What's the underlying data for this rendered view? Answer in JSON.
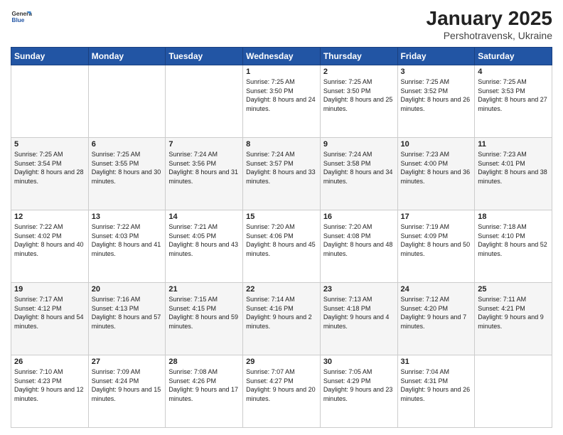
{
  "header": {
    "logo": {
      "general": "General",
      "blue": "Blue"
    },
    "title": "January 2025",
    "location": "Pershotravensk, Ukraine"
  },
  "weekdays": [
    "Sunday",
    "Monday",
    "Tuesday",
    "Wednesday",
    "Thursday",
    "Friday",
    "Saturday"
  ],
  "weeks": [
    [
      {
        "day": "",
        "sunrise": "",
        "sunset": "",
        "daylight": ""
      },
      {
        "day": "",
        "sunrise": "",
        "sunset": "",
        "daylight": ""
      },
      {
        "day": "",
        "sunrise": "",
        "sunset": "",
        "daylight": ""
      },
      {
        "day": "1",
        "sunrise": "Sunrise: 7:25 AM",
        "sunset": "Sunset: 3:50 PM",
        "daylight": "Daylight: 8 hours and 24 minutes."
      },
      {
        "day": "2",
        "sunrise": "Sunrise: 7:25 AM",
        "sunset": "Sunset: 3:50 PM",
        "daylight": "Daylight: 8 hours and 25 minutes."
      },
      {
        "day": "3",
        "sunrise": "Sunrise: 7:25 AM",
        "sunset": "Sunset: 3:52 PM",
        "daylight": "Daylight: 8 hours and 26 minutes."
      },
      {
        "day": "4",
        "sunrise": "Sunrise: 7:25 AM",
        "sunset": "Sunset: 3:53 PM",
        "daylight": "Daylight: 8 hours and 27 minutes."
      }
    ],
    [
      {
        "day": "5",
        "sunrise": "Sunrise: 7:25 AM",
        "sunset": "Sunset: 3:54 PM",
        "daylight": "Daylight: 8 hours and 28 minutes."
      },
      {
        "day": "6",
        "sunrise": "Sunrise: 7:25 AM",
        "sunset": "Sunset: 3:55 PM",
        "daylight": "Daylight: 8 hours and 30 minutes."
      },
      {
        "day": "7",
        "sunrise": "Sunrise: 7:24 AM",
        "sunset": "Sunset: 3:56 PM",
        "daylight": "Daylight: 8 hours and 31 minutes."
      },
      {
        "day": "8",
        "sunrise": "Sunrise: 7:24 AM",
        "sunset": "Sunset: 3:57 PM",
        "daylight": "Daylight: 8 hours and 33 minutes."
      },
      {
        "day": "9",
        "sunrise": "Sunrise: 7:24 AM",
        "sunset": "Sunset: 3:58 PM",
        "daylight": "Daylight: 8 hours and 34 minutes."
      },
      {
        "day": "10",
        "sunrise": "Sunrise: 7:23 AM",
        "sunset": "Sunset: 4:00 PM",
        "daylight": "Daylight: 8 hours and 36 minutes."
      },
      {
        "day": "11",
        "sunrise": "Sunrise: 7:23 AM",
        "sunset": "Sunset: 4:01 PM",
        "daylight": "Daylight: 8 hours and 38 minutes."
      }
    ],
    [
      {
        "day": "12",
        "sunrise": "Sunrise: 7:22 AM",
        "sunset": "Sunset: 4:02 PM",
        "daylight": "Daylight: 8 hours and 40 minutes."
      },
      {
        "day": "13",
        "sunrise": "Sunrise: 7:22 AM",
        "sunset": "Sunset: 4:03 PM",
        "daylight": "Daylight: 8 hours and 41 minutes."
      },
      {
        "day": "14",
        "sunrise": "Sunrise: 7:21 AM",
        "sunset": "Sunset: 4:05 PM",
        "daylight": "Daylight: 8 hours and 43 minutes."
      },
      {
        "day": "15",
        "sunrise": "Sunrise: 7:20 AM",
        "sunset": "Sunset: 4:06 PM",
        "daylight": "Daylight: 8 hours and 45 minutes."
      },
      {
        "day": "16",
        "sunrise": "Sunrise: 7:20 AM",
        "sunset": "Sunset: 4:08 PM",
        "daylight": "Daylight: 8 hours and 48 minutes."
      },
      {
        "day": "17",
        "sunrise": "Sunrise: 7:19 AM",
        "sunset": "Sunset: 4:09 PM",
        "daylight": "Daylight: 8 hours and 50 minutes."
      },
      {
        "day": "18",
        "sunrise": "Sunrise: 7:18 AM",
        "sunset": "Sunset: 4:10 PM",
        "daylight": "Daylight: 8 hours and 52 minutes."
      }
    ],
    [
      {
        "day": "19",
        "sunrise": "Sunrise: 7:17 AM",
        "sunset": "Sunset: 4:12 PM",
        "daylight": "Daylight: 8 hours and 54 minutes."
      },
      {
        "day": "20",
        "sunrise": "Sunrise: 7:16 AM",
        "sunset": "Sunset: 4:13 PM",
        "daylight": "Daylight: 8 hours and 57 minutes."
      },
      {
        "day": "21",
        "sunrise": "Sunrise: 7:15 AM",
        "sunset": "Sunset: 4:15 PM",
        "daylight": "Daylight: 8 hours and 59 minutes."
      },
      {
        "day": "22",
        "sunrise": "Sunrise: 7:14 AM",
        "sunset": "Sunset: 4:16 PM",
        "daylight": "Daylight: 9 hours and 2 minutes."
      },
      {
        "day": "23",
        "sunrise": "Sunrise: 7:13 AM",
        "sunset": "Sunset: 4:18 PM",
        "daylight": "Daylight: 9 hours and 4 minutes."
      },
      {
        "day": "24",
        "sunrise": "Sunrise: 7:12 AM",
        "sunset": "Sunset: 4:20 PM",
        "daylight": "Daylight: 9 hours and 7 minutes."
      },
      {
        "day": "25",
        "sunrise": "Sunrise: 7:11 AM",
        "sunset": "Sunset: 4:21 PM",
        "daylight": "Daylight: 9 hours and 9 minutes."
      }
    ],
    [
      {
        "day": "26",
        "sunrise": "Sunrise: 7:10 AM",
        "sunset": "Sunset: 4:23 PM",
        "daylight": "Daylight: 9 hours and 12 minutes."
      },
      {
        "day": "27",
        "sunrise": "Sunrise: 7:09 AM",
        "sunset": "Sunset: 4:24 PM",
        "daylight": "Daylight: 9 hours and 15 minutes."
      },
      {
        "day": "28",
        "sunrise": "Sunrise: 7:08 AM",
        "sunset": "Sunset: 4:26 PM",
        "daylight": "Daylight: 9 hours and 17 minutes."
      },
      {
        "day": "29",
        "sunrise": "Sunrise: 7:07 AM",
        "sunset": "Sunset: 4:27 PM",
        "daylight": "Daylight: 9 hours and 20 minutes."
      },
      {
        "day": "30",
        "sunrise": "Sunrise: 7:05 AM",
        "sunset": "Sunset: 4:29 PM",
        "daylight": "Daylight: 9 hours and 23 minutes."
      },
      {
        "day": "31",
        "sunrise": "Sunrise: 7:04 AM",
        "sunset": "Sunset: 4:31 PM",
        "daylight": "Daylight: 9 hours and 26 minutes."
      },
      {
        "day": "",
        "sunrise": "",
        "sunset": "",
        "daylight": ""
      }
    ]
  ]
}
